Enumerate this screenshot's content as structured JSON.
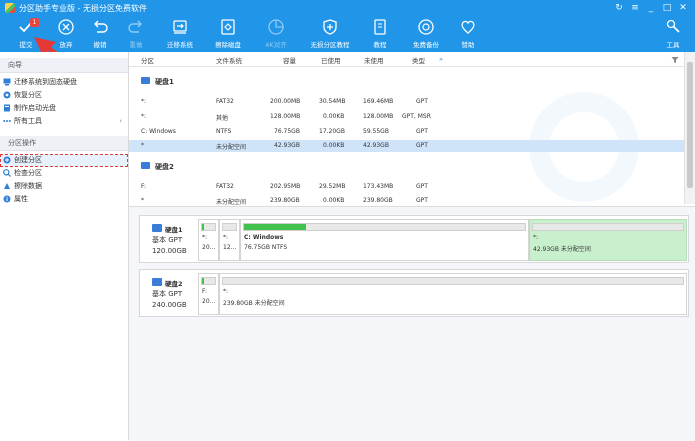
{
  "window": {
    "title": "分区助手专业版 - 无损分区免费软件",
    "controls": [
      "↻",
      "≡",
      "_",
      "□",
      "✕"
    ]
  },
  "toolbar": {
    "submit_label": "提交",
    "submit_badge": "1",
    "discard_label": "放弃",
    "undo_label": "撤销",
    "redo_label": "重做",
    "migrate_os_label": "迁移系统",
    "wipe_disk_label": "擦除磁盘",
    "partition_align_label": "4K对齐",
    "free_backup_label": "无损分区教程",
    "tutorial_label": "教程",
    "free_backup2_label": "免费备份",
    "donate_label": "赞助",
    "tools_label": "工具"
  },
  "sidebar": {
    "wizard_header": "向导",
    "wizard_items": [
      {
        "label": "迁移系统到固态硬盘"
      },
      {
        "label": "恢复分区"
      },
      {
        "label": "制作启动光盘"
      },
      {
        "label": "所有工具"
      }
    ],
    "ops_header": "分区操作",
    "ops_items": [
      {
        "label": "创建分区"
      },
      {
        "label": "检查分区"
      },
      {
        "label": "擦除数据"
      },
      {
        "label": "属性"
      }
    ]
  },
  "table": {
    "headers": [
      "分区",
      "文件系统",
      "容量",
      "已使用",
      "未使用",
      "类型",
      "»"
    ],
    "disk1_name": "硬盘1",
    "disk2_name": "硬盘2",
    "disk1_rows": [
      [
        "*:",
        "FAT32",
        "200.00MB",
        "30.54MB",
        "169.46MB",
        "GPT"
      ],
      [
        "*:",
        "其他",
        "128.00MB",
        "0.00KB",
        "128.00MB",
        "GPT, MSR"
      ],
      [
        "C: Windows",
        "NTFS",
        "76.75GB",
        "17.20GB",
        "59.55GB",
        "GPT"
      ],
      [
        "*",
        "未分配空间",
        "42.93GB",
        "0.00KB",
        "42.93GB",
        "GPT"
      ]
    ],
    "disk2_rows": [
      [
        "F:",
        "FAT32",
        "202.95MB",
        "29.52MB",
        "173.43MB",
        "GPT"
      ],
      [
        "*",
        "未分配空间",
        "239.80GB",
        "0.00KB",
        "239.80GB",
        "GPT"
      ]
    ]
  },
  "diskmap": {
    "disk1": {
      "name": "硬盘1",
      "type": "基本 GPT",
      "size": "120.00GB",
      "p1": {
        "l1": "*:",
        "l2": "20...",
        "fill": 0.15
      },
      "p2": {
        "l1": "*:",
        "l2": "12...",
        "fill": 0
      },
      "p3": {
        "l1": "C: Windows",
        "l2": "76.75GB NTFS",
        "fill": 0.22
      },
      "p4": {
        "l1": "*:",
        "l2": "42.93GB 未分配空间",
        "fill": 0
      }
    },
    "disk2": {
      "name": "硬盘2",
      "type": "基本 GPT",
      "size": "240.00GB",
      "p1": {
        "l1": "F:",
        "l2": "20...",
        "fill": 0.15
      },
      "p2": {
        "l1": "*:",
        "l2": "239.80GB 未分配空间",
        "fill": 0
      }
    }
  },
  "colors": {
    "accent": "#2196e9",
    "selected_row": "#cfe4f9",
    "unallocated": "#c9f0cc",
    "used_fill": "#42c24c",
    "annotation": "#e53935"
  }
}
